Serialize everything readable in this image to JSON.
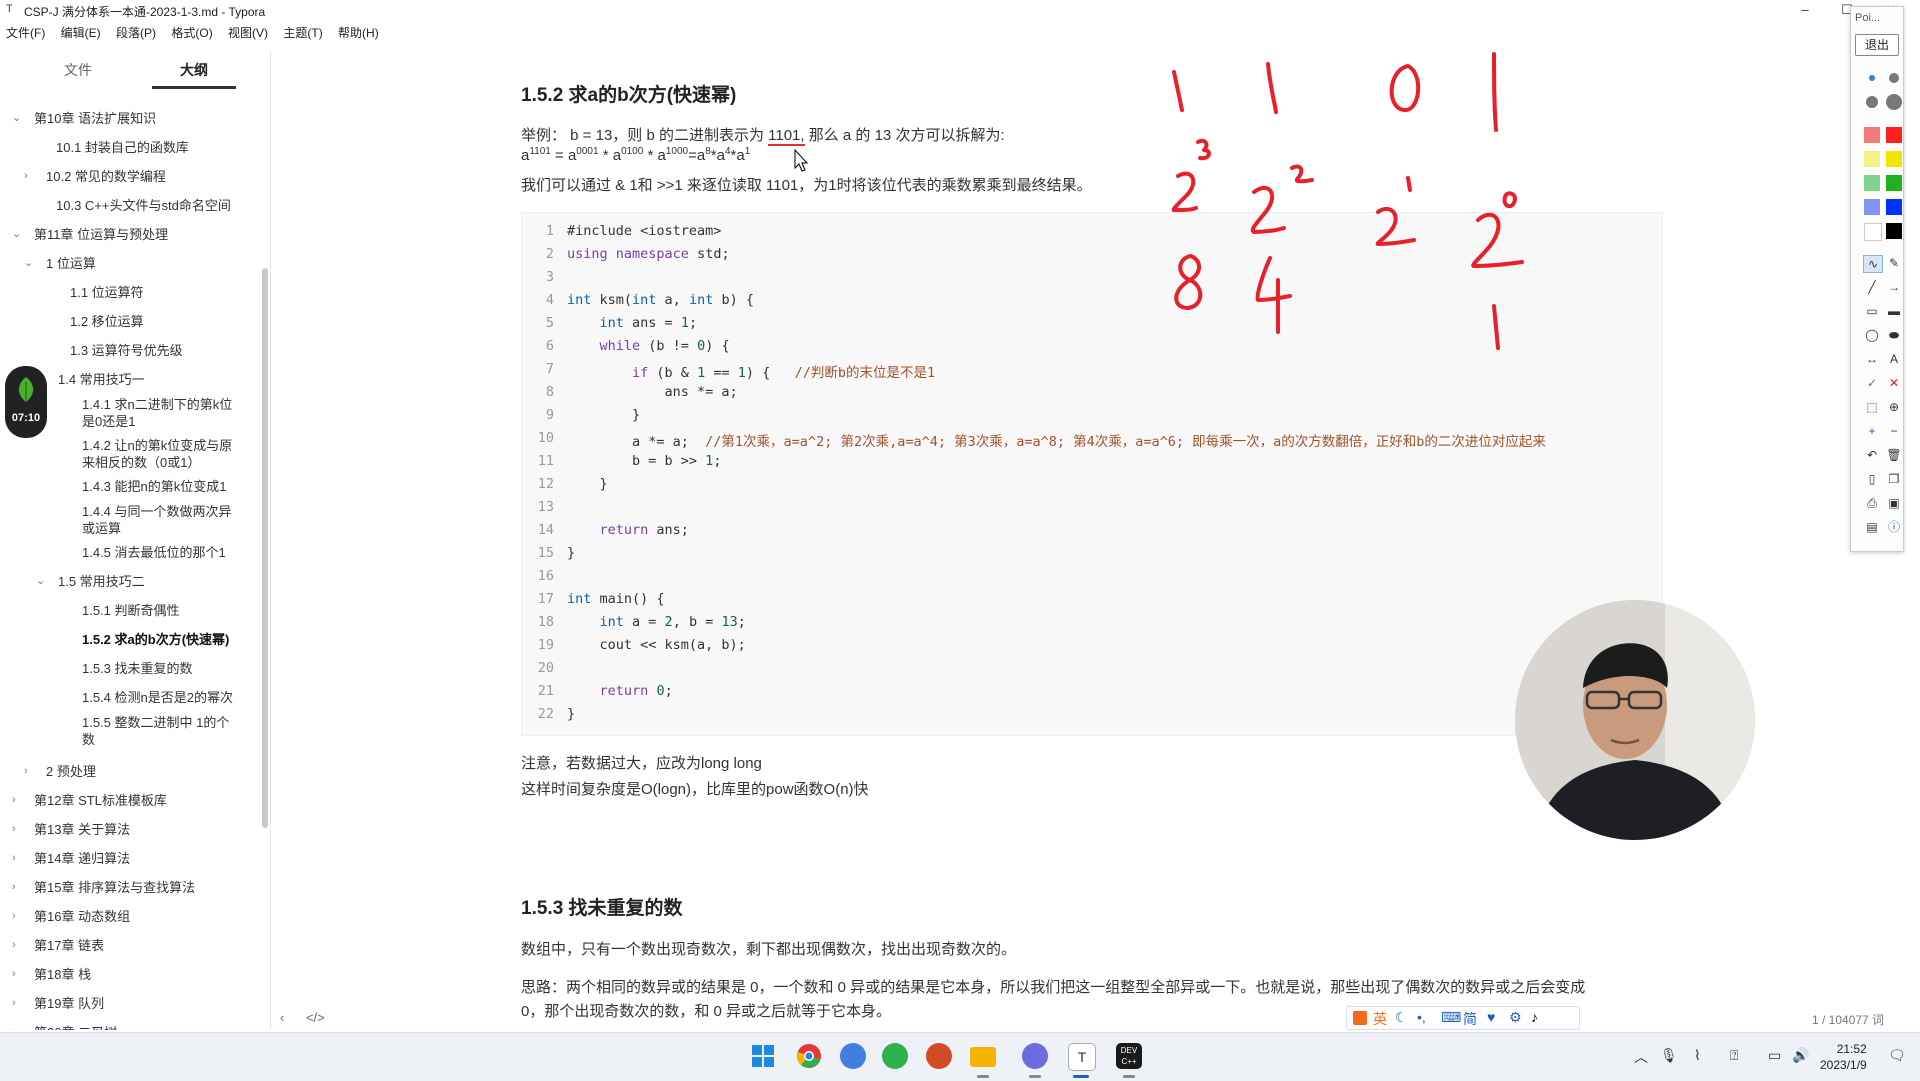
{
  "window": {
    "title": "CSP-J 满分体系一本通-2023-1-3.md - Typora",
    "minimize": "–",
    "maximize": "☐",
    "close": "✕"
  },
  "menu": [
    "文件(F)",
    "编辑(E)",
    "段落(P)",
    "格式(O)",
    "视图(V)",
    "主题(T)",
    "帮助(H)"
  ],
  "sidebar": {
    "tab_files": "文件",
    "tab_outline": "大纲",
    "outline": [
      {
        "label": "第10章 语法扩展知识",
        "twisty": "⌄"
      },
      {
        "label": "10.1 封装自己的函数库",
        "twisty": ""
      },
      {
        "label": "10.2 常见的数学编程",
        "twisty": "›"
      },
      {
        "label": "10.3 C++头文件与std命名空间",
        "twisty": ""
      },
      {
        "label": "第11章 位运算与预处理",
        "twisty": "⌄"
      },
      {
        "label": "1 位运算",
        "twisty": "⌄"
      },
      {
        "label": "1.1 位运算符",
        "twisty": ""
      },
      {
        "label": "1.2 移位运算",
        "twisty": ""
      },
      {
        "label": "1.3 运算符号优先级",
        "twisty": ""
      },
      {
        "label": "1.4 常用技巧一",
        "twisty": "⌄"
      },
      {
        "label": "1.4.1 求n二进制下的第k位",
        "label2": "是0还是1",
        "twisty": ""
      },
      {
        "label": "1.4.2 让n的第k位变成与原",
        "label2": "来相反的数（0或1）",
        "twisty": ""
      },
      {
        "label": "1.4.3 能把n的第k位变成1",
        "twisty": ""
      },
      {
        "label": "1.4.4 与同一个数做两次异",
        "label2": "或运算",
        "twisty": ""
      },
      {
        "label": "1.4.5 消去最低位的那个1",
        "twisty": ""
      },
      {
        "label": "1.5 常用技巧二",
        "twisty": "⌄"
      },
      {
        "label": "1.5.1 判断奇偶性",
        "twisty": ""
      },
      {
        "label": "1.5.2 求a的b次方(快速幂)",
        "twisty": "",
        "active": true
      },
      {
        "label": "1.5.3 找未重复的数",
        "twisty": ""
      },
      {
        "label": "1.5.4 检测n是否是2的幂次",
        "twisty": ""
      },
      {
        "label": "1.5.5 整数二进制中 1的个",
        "label2": "数",
        "twisty": ""
      },
      {
        "label": "2 预处理",
        "twisty": "›"
      },
      {
        "label": "第12章 STL标准模板库",
        "twisty": "›"
      },
      {
        "label": "第13章 关于算法",
        "twisty": "›"
      },
      {
        "label": "第14章 递归算法",
        "twisty": "›"
      },
      {
        "label": "第15章 排序算法与查找算法",
        "twisty": "›"
      },
      {
        "label": "第16章 动态数组",
        "twisty": "›"
      },
      {
        "label": "第17章 链表",
        "twisty": "›"
      },
      {
        "label": "第18章 栈",
        "twisty": "›"
      },
      {
        "label": "第19章 队列",
        "twisty": "›"
      },
      {
        "label": "第20章 二叉树",
        "twisty": "›"
      }
    ],
    "timer": "07:10",
    "bottom_left": "‹",
    "bottom_code": "</>"
  },
  "doc": {
    "h_152": "1.5.2 求a的b次方(快速幂)",
    "ex_a": "举例： b = 13，则 b 的二进制表示为 ",
    "ex_hl": "1101,",
    "ex_b": " 那么 a 的 13 次方可以拆解为:",
    "eq": {
      "base": "a",
      "e0": "1101",
      "t1": " = a",
      "e1": "0001",
      "t2": " * a",
      "e2": "0100",
      "t3": " * a",
      "e3": "1000",
      "t4": "=a",
      "e4": "8",
      "t5": "*a",
      "e5": "4",
      "t6": "*a",
      "e6": "1"
    },
    "p_read": "我们可以通过 & 1和 >>1 来逐位读取 1101，为1时将该位代表的乘数累乘到最终结果。",
    "code": [
      "#include <iostream>",
      "using namespace std;",
      "",
      "int ksm(int a, int b) {",
      "    int ans = 1;",
      "    while (b != 0) {",
      "        if (b & 1 == 1) {   //判断b的末位是不是1",
      "            ans *= a;",
      "        }",
      "        a *= a;  //第1次乘，a=a^2; 第2次乘,a=a^4; 第3次乘，a=a^8; 第4次乘，a=a^6; 即每乘一次，a的次方数翻倍，正好和b的二次进位对应起来",
      "        b = b >> 1;",
      "    }",
      "",
      "    return ans;",
      "}",
      "",
      "int main() {",
      "    int a = 2, b = 13;",
      "    cout << ksm(a, b);",
      "",
      "    return 0;",
      "}"
    ],
    "note1": "注意，若数据过大，应改为long  long",
    "note2": "这样时间复杂度是O(logn)，比库里的pow函数O(n)快",
    "h_153": "1.5.3  找未重复的数",
    "p_153a": "数组中，只有一个数出现奇数次，剩下都出现偶数次，找出出现奇数次的。",
    "p_153b": "思路：两个相同的数异或的结果是 0，一个数和 0 异或的结果是它本身，所以我们把这一组整型全部异或一下。也就是说，那些出现了偶数次的数异或之后会变成",
    "p_153c": "0，那个出现奇数次的数，和 0 异或之后就等于它本身。",
    "word_count": "1 / 104077 词"
  },
  "ink": {
    "color": "#e8202a",
    "marks": [
      "1",
      "1",
      "0",
      "1",
      "2",
      "3",
      "2",
      "2",
      "2",
      "1",
      "2",
      "0",
      "8",
      "4",
      "1"
    ]
  },
  "pentool": {
    "title": "Poi...",
    "exit": "退出",
    "swatches": [
      "#f47a7a",
      "#ff2020",
      "#f5f08a",
      "#f2e400",
      "#7fd48c",
      "#1db31d",
      "#7c95f0",
      "#0033ff",
      "#ffffff",
      "#000000"
    ],
    "tools": [
      "pen-icon",
      "eraser-icon",
      "line-icon",
      "arrow-icon",
      "rectangle-icon",
      "filled-rectangle-icon",
      "ellipse-icon",
      "filled-ellipse-icon",
      "double-arrow-icon",
      "text-icon",
      "check-icon",
      "cross-icon",
      "select-icon",
      "zoom-icon",
      "plus-icon",
      "minus-icon",
      "undo-icon",
      "trash-icon",
      "page-icon",
      "copy-icon",
      "print-icon",
      "save-icon",
      "board-icon",
      "info-icon"
    ],
    "text_tool": "A"
  },
  "ime": {
    "items": [
      "英",
      "简"
    ]
  },
  "taskbar": {
    "apps": [
      "windows-start-icon",
      "chrome-icon",
      "copilot-icon",
      "wechat-icon",
      "office-icon",
      "file-explorer-icon",
      "photo-app-icon",
      "typora-icon",
      "devcpp-icon"
    ],
    "typora_glyph": "T",
    "devcpp_glyph": "DEV\nC++",
    "clock_time": "21:52",
    "clock_date": "2023/1/9"
  }
}
